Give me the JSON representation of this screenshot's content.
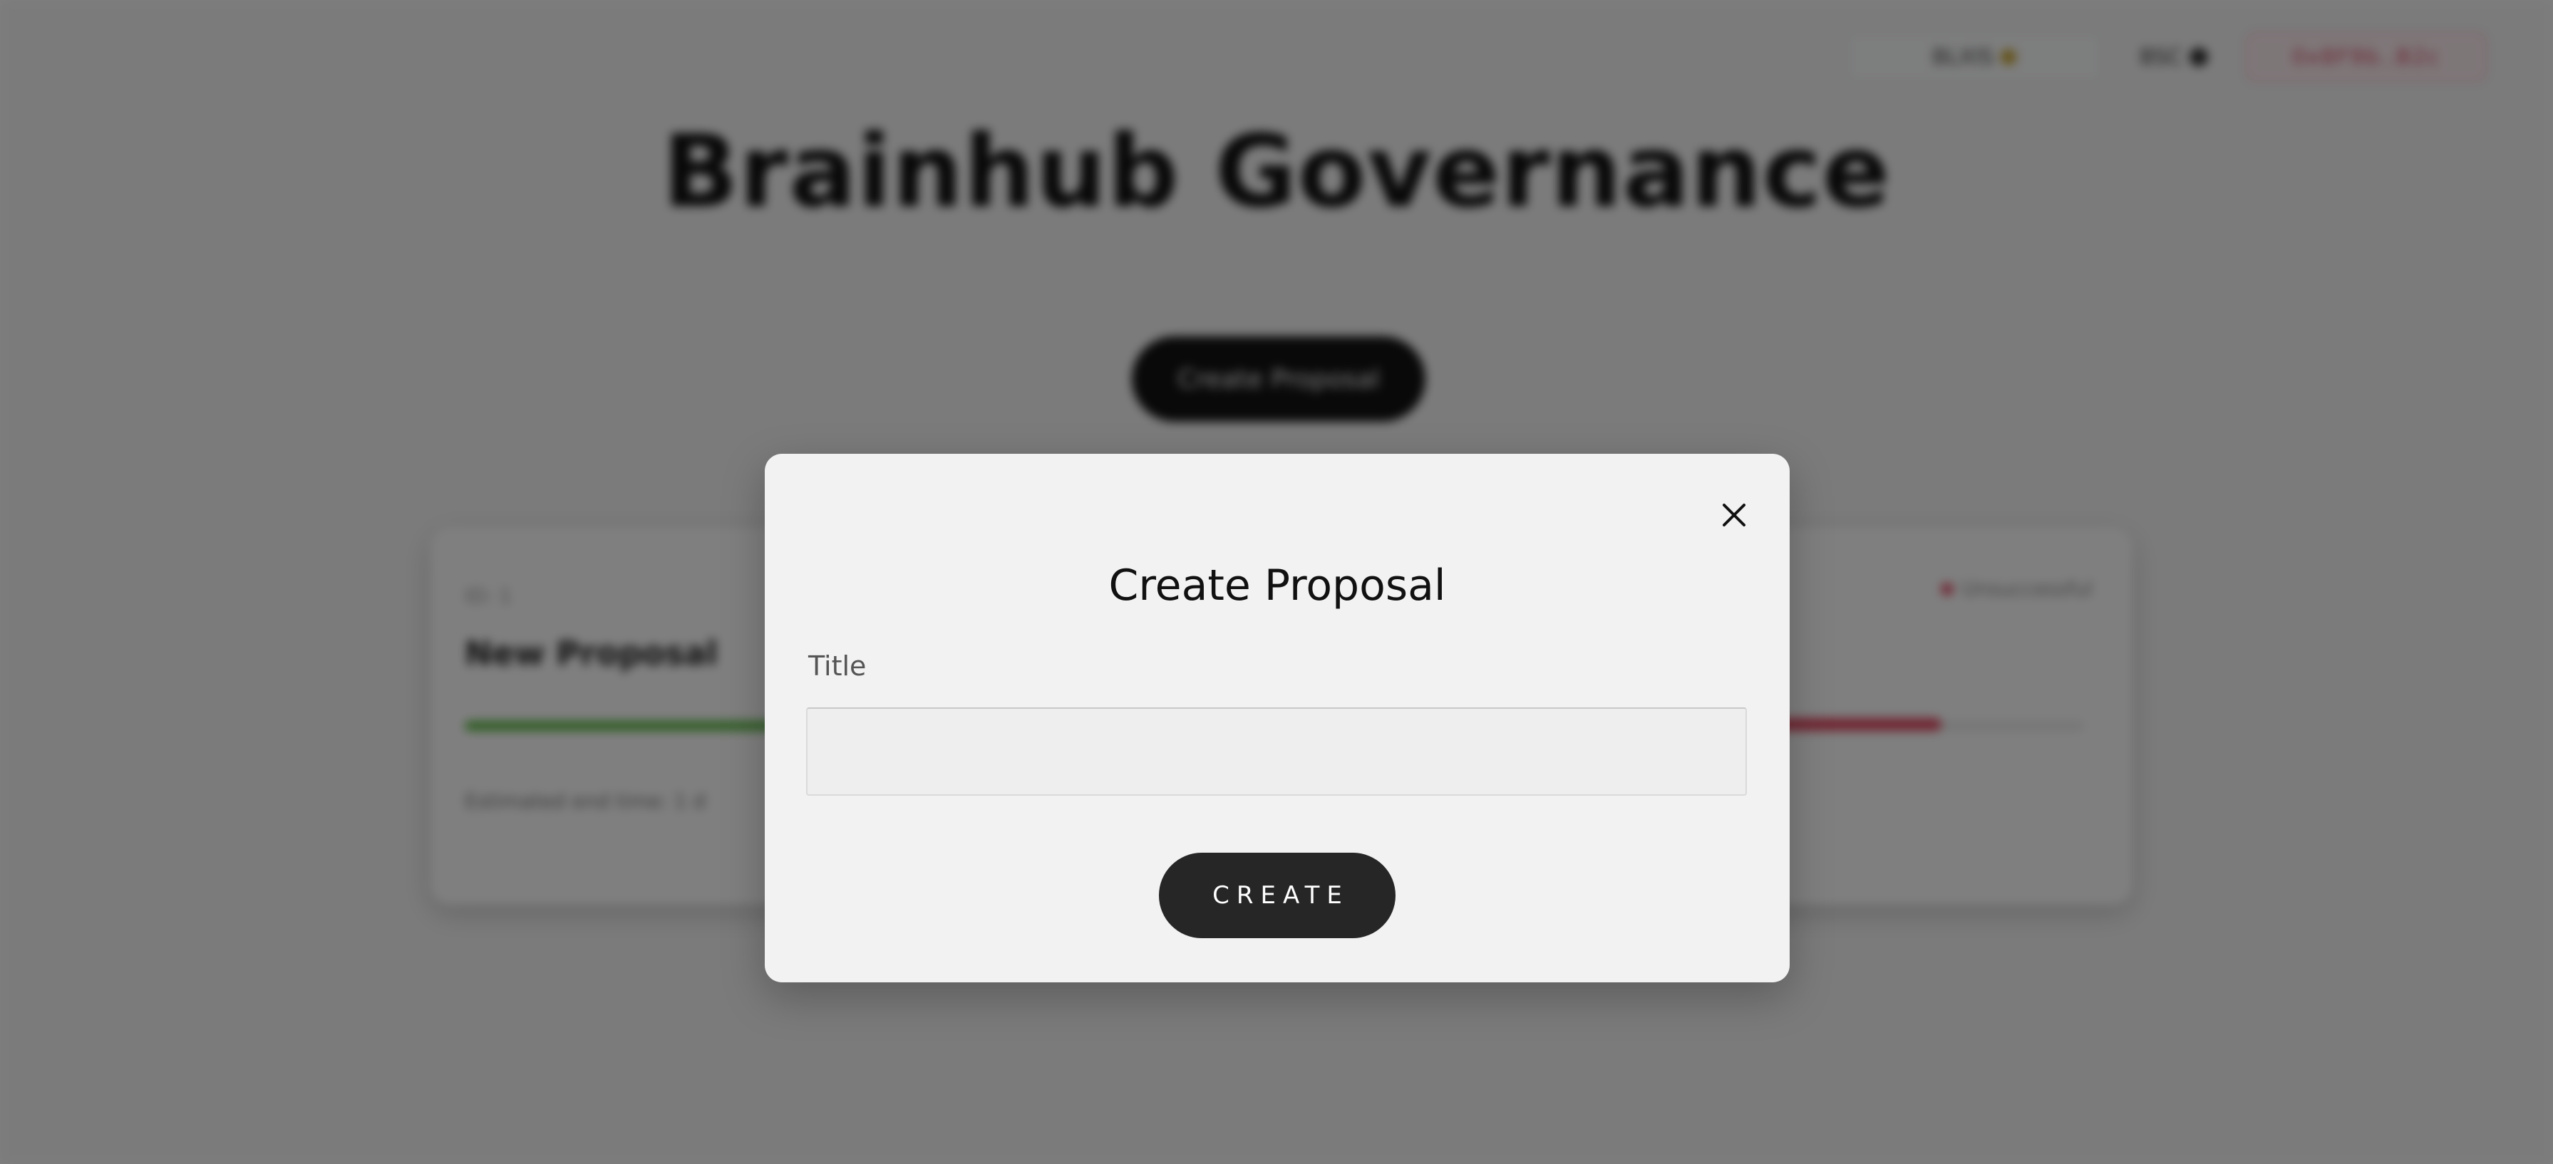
{
  "header": {
    "balance_label": "BLXIS",
    "network_label": "BSC",
    "address_label": "0x8F9b..B2c"
  },
  "page": {
    "title": "Brainhub Governance",
    "create_button_label": "Create Proposal"
  },
  "proposal_card": {
    "id_label": "ID: 1",
    "name": "New Proposal",
    "status": "Unsuccessful",
    "votes_for_fraction": 0.36,
    "votes_against_fraction": 0.46,
    "meta_text": "Estimated end time: 1 d"
  },
  "modal": {
    "title": "Create Proposal",
    "field_label": "Title",
    "title_value": "",
    "title_placeholder": "",
    "submit_label": "CREATE",
    "close_icon": "close-icon"
  },
  "colors": {
    "overlay": "#000000",
    "modal_bg": "#f2f2f2",
    "button_bg": "#262626",
    "bar_for": "#5dbb46",
    "bar_against": "#e04a62"
  }
}
